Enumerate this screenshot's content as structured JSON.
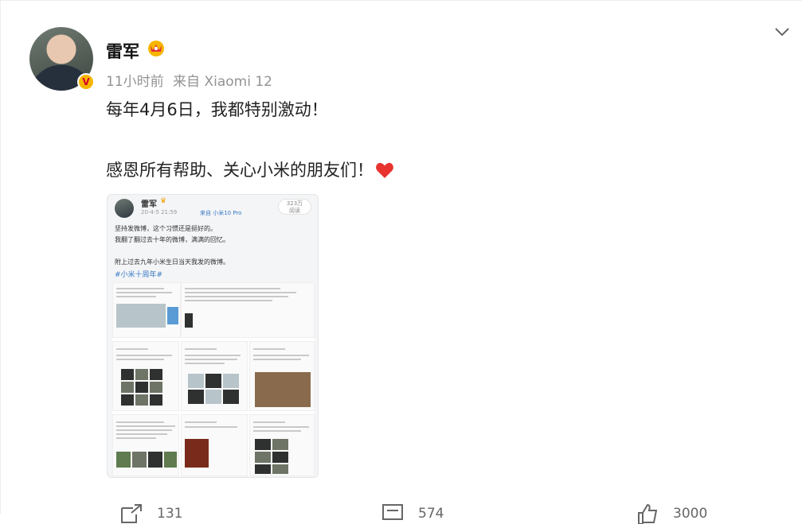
{
  "post": {
    "username": "雷军",
    "time": "11小时前",
    "source": "来自 Xiaomi 12",
    "line1": "每年4月6日，我都特别激动！",
    "line2": "感恩所有帮助、关心小米的朋友们！"
  },
  "embed": {
    "name": "雷军",
    "time": "20-4-5 21:59",
    "source": "来自 小米10 Pro",
    "views_number": "323万",
    "views_label": "阅读",
    "text1": "坚持发微博，这个习惯还是挺好的。",
    "text2": "我翻了翻过去十年的微博，满满的回忆。",
    "text3": "附上过去九年小米生日当天我发的微博。",
    "hashtag": "#小米十周年#"
  },
  "actions": {
    "repost": "131",
    "comment": "574",
    "like": "3000"
  },
  "colors": {
    "link": "#3578c4",
    "meta": "#939393",
    "heart": "#e8332f",
    "badge": "#f7b500"
  }
}
